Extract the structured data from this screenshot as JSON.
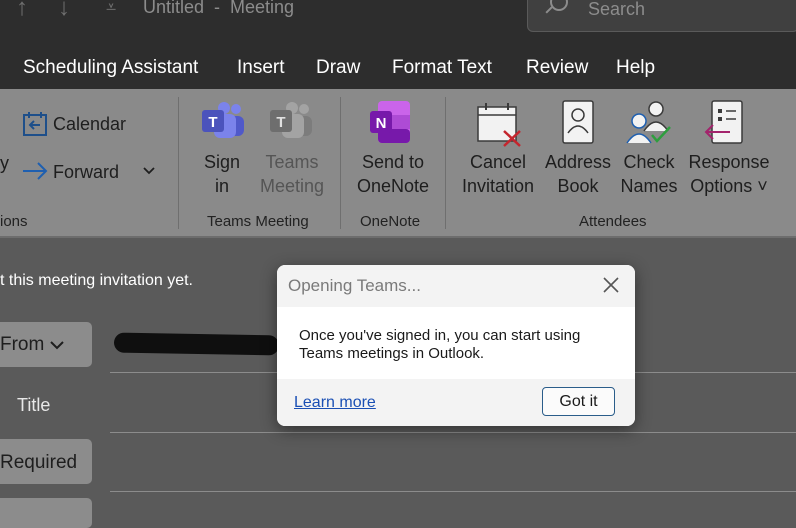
{
  "window": {
    "title": "Untitled  -  Meeting",
    "search_placeholder": "Search"
  },
  "menu": {
    "items": [
      "Scheduling Assistant",
      "Insert",
      "Draw",
      "Format Text",
      "Review",
      "Help"
    ]
  },
  "ribbon": {
    "calendar_label": "Calendar",
    "forward_label": "Forward",
    "partial_letter": "y",
    "partial_group_label": "ions",
    "sign_in_label": [
      "Sign",
      "in"
    ],
    "teams_meeting_button_label": [
      "Teams",
      "Meeting"
    ],
    "teams_group_label": "Teams Meeting",
    "send_onenote_label": [
      "Send to",
      "OneNote"
    ],
    "onenote_group_label": "OneNote",
    "cancel_label": [
      "Cancel",
      "Invitation"
    ],
    "address_book_label": [
      "Address",
      "Book"
    ],
    "check_names_label": [
      "Check",
      "Names"
    ],
    "response_options_label": [
      "Response",
      "Options ˅"
    ],
    "attendees_group_label": "Attendees"
  },
  "form": {
    "notice": "t this meeting invitation yet.",
    "from_button": "From",
    "title_label": "Title",
    "required_button": "Required"
  },
  "dialog": {
    "title": "Opening Teams...",
    "message": "Once you've signed in, you can start using Teams meetings in Outlook.",
    "learn_more": "Learn more",
    "confirm_button": "Got it"
  },
  "colors": {
    "accent": "#2a5d8a",
    "link": "#1a4fb4",
    "onenote": "#7719aa",
    "teams": "#4b53bc"
  }
}
